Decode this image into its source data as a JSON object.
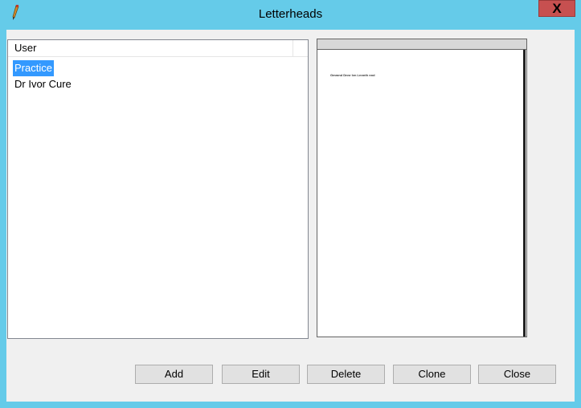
{
  "window": {
    "title": "Letterheads",
    "close_glyph": "X",
    "app_icon": "pen-icon",
    "close_color": "#c75050",
    "titlebar_color": "#65cbe9"
  },
  "list": {
    "column_header": "User",
    "items": [
      {
        "label": "Practice",
        "selected": true
      },
      {
        "label": "Dr Ivor Cure",
        "selected": false
      }
    ],
    "selection_color": "#3399ff"
  },
  "preview": {
    "text": "Gmmnd Dnnr Ivn Lnnnth nnd"
  },
  "buttons": {
    "add": "Add",
    "edit": "Edit",
    "delete": "Delete",
    "clone": "Clone",
    "close": "Close"
  }
}
